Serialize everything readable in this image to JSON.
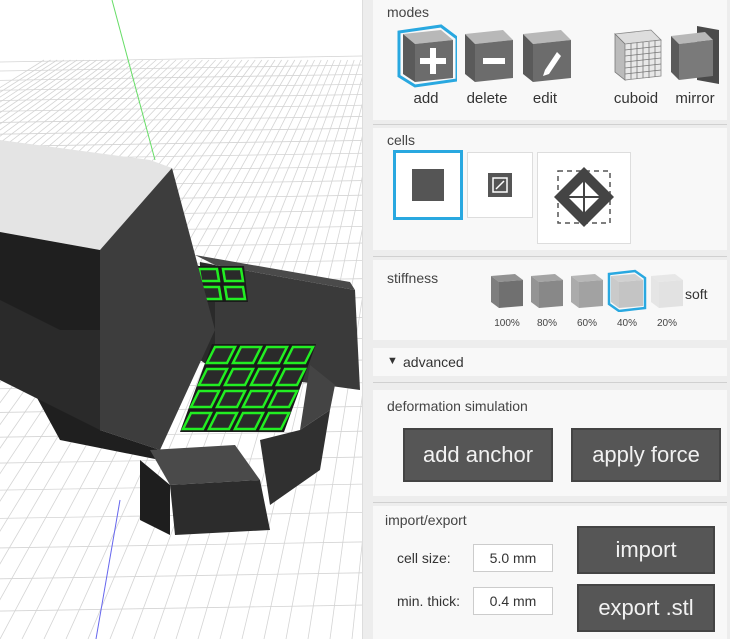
{
  "modes": {
    "title": "modes",
    "items": [
      {
        "label": "add",
        "icon": "add-cube-icon",
        "selected": true
      },
      {
        "label": "delete",
        "icon": "delete-cube-icon",
        "selected": false
      },
      {
        "label": "edit",
        "icon": "edit-cube-icon",
        "selected": false
      },
      {
        "label": "cuboid",
        "icon": "cuboid-grid-icon",
        "selected": false
      },
      {
        "label": "mirror",
        "icon": "mirror-cube-icon",
        "selected": false
      }
    ]
  },
  "cells": {
    "title": "cells",
    "items": [
      {
        "icon": "solid-cell-icon",
        "selected": true
      },
      {
        "icon": "resize-cell-icon",
        "selected": false
      },
      {
        "icon": "diamond-cell-icon",
        "selected": false
      }
    ]
  },
  "stiffness": {
    "title": "stiffness",
    "end_label": "soft",
    "levels": [
      "100%",
      "80%",
      "60%",
      "40%",
      "20%"
    ],
    "selected": "40%"
  },
  "advanced": {
    "toggle_label": "advanced"
  },
  "deformation": {
    "title": "deformation simulation",
    "add_anchor_label": "add anchor",
    "apply_force_label": "apply force"
  },
  "import_export": {
    "title": "import/export",
    "cell_size_label": "cell size:",
    "cell_size_value": "5.0 mm",
    "min_thick_label": "min. thick:",
    "min_thick_value": "0.4 mm",
    "import_label": "import",
    "export_label": "export .stl"
  },
  "colors": {
    "accent": "#29a8e0",
    "highlight": "#22ee22",
    "button": "#565656"
  }
}
